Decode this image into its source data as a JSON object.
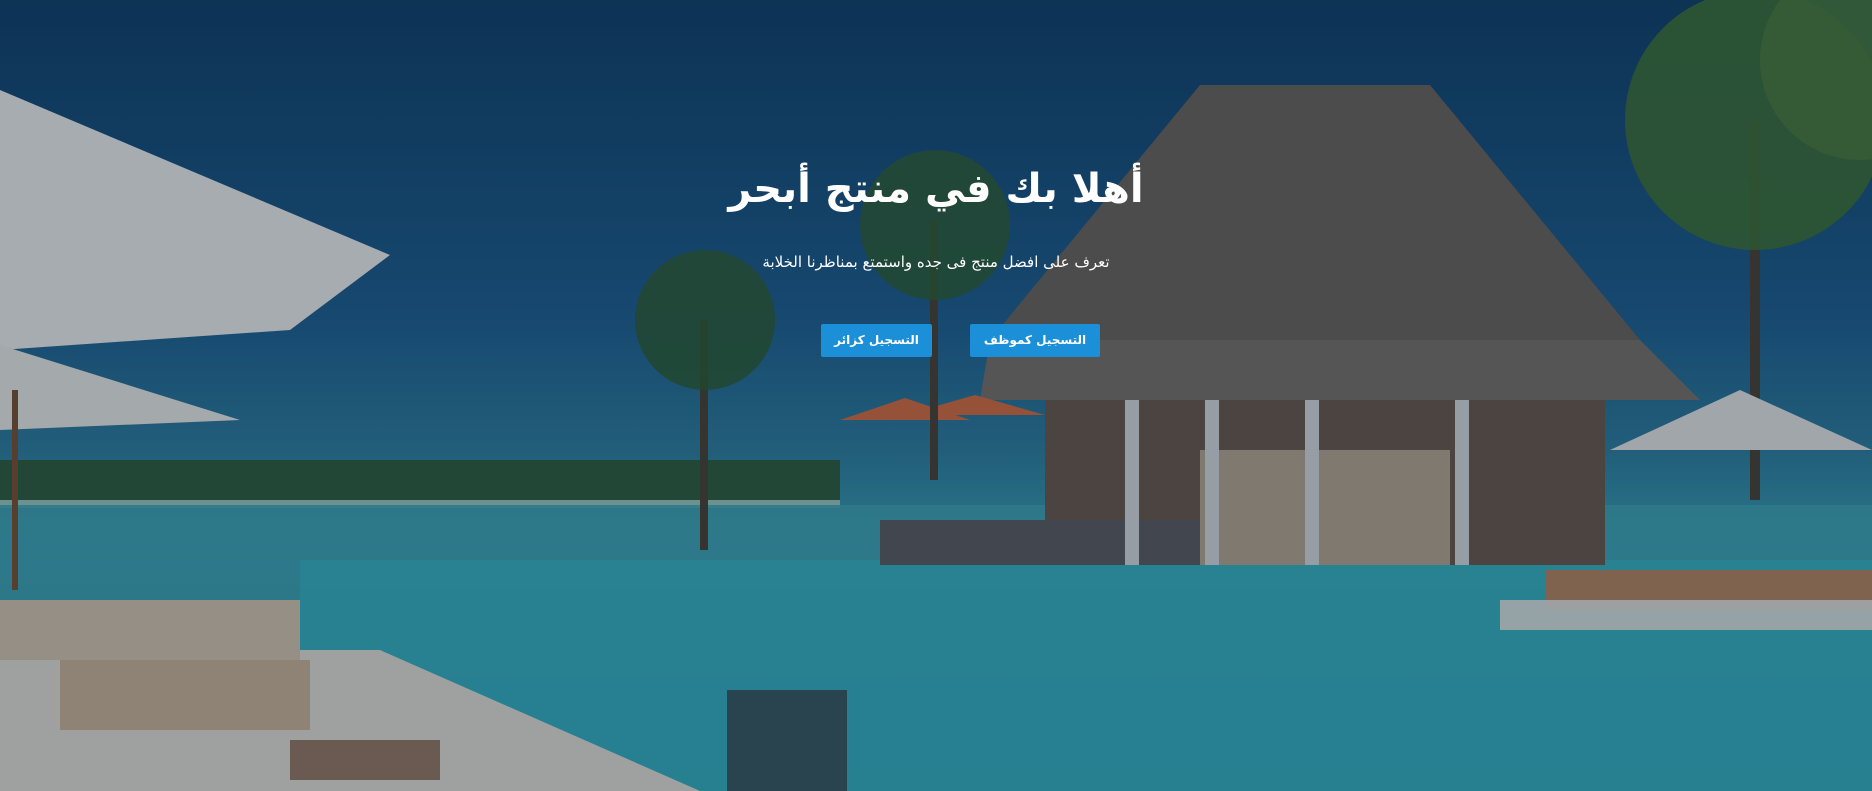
{
  "hero": {
    "title": "أهلا بك في منتج أبحر",
    "subtitle": "تعرف على افضل منتج فى جده واستمتع بمناظرنا الخلابة",
    "buttons": {
      "register_employee": "التسجيل كموظف",
      "register_visitor": "التسجيل كزائر"
    }
  },
  "colors": {
    "button_bg": "#1b8fd8",
    "text": "#ffffff"
  },
  "background": {
    "scene": "resort-pool-photo"
  }
}
